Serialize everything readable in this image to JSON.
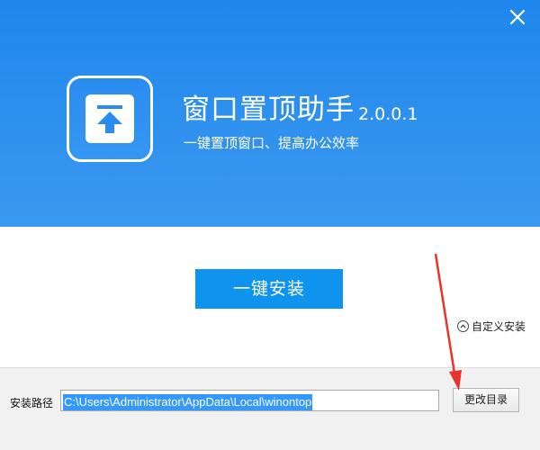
{
  "app": {
    "title": "窗口置顶助手",
    "version": "2.0.0.1",
    "subtitle": "一键置顶窗口、提高办公效率"
  },
  "actions": {
    "install_label": "一键安装",
    "custom_install_label": "自定义安装"
  },
  "install_path": {
    "label": "安装路径",
    "value": "C:\\Users\\Administrator\\AppData\\Local\\winontop",
    "browse_label": "更改目录"
  },
  "colors": {
    "header_blue": "#2f91ee",
    "install_button": "#0e93ee",
    "selection": "#3399ff",
    "annotation_arrow": "#e8342b"
  },
  "icons": {
    "close": "close-icon",
    "app": "pin-to-top-icon",
    "custom_install": "chevron-up-circle-icon"
  }
}
